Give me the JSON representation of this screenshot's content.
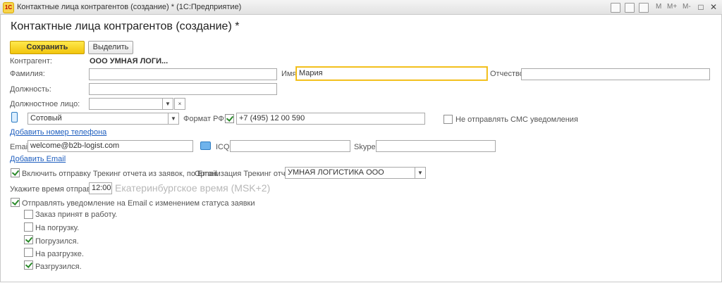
{
  "window": {
    "title": "Контактные лица контрагентов (создание) * (1С:Предприятие)",
    "logo": "1С",
    "toolbar_labels": [
      "M",
      "M+",
      "M-"
    ],
    "controls": [
      "□",
      "✕"
    ]
  },
  "form": {
    "title": "Контактные лица контрагентов (создание) *",
    "buttons": {
      "save": "Сохранить",
      "select": "Выделить"
    },
    "counterparty": {
      "label": "Контрагент:",
      "value": "ООО УМНАЯ ЛОГИ..."
    },
    "surname": {
      "label": "Фамилия:",
      "value": ""
    },
    "name": {
      "label": "Имя:",
      "value": "Мария"
    },
    "patronymic": {
      "label": "Отчество:",
      "value": ""
    },
    "position": {
      "label": "Должность:",
      "value": ""
    },
    "official_position": {
      "label": "Должностное лицо:",
      "value": ""
    },
    "phone": {
      "type_value": "Сотовый",
      "format_label": "Формат РФ:",
      "format_checked": true,
      "number": "+7 (495) 12 00 590",
      "no_sms_label": "Не отправлять СМС уведомления",
      "no_sms_checked": false,
      "add_link": "Добавить номер телефона"
    },
    "email": {
      "label": "Email:",
      "value": "welcome@b2b-logist.com",
      "icq_label": "ICQ:",
      "icq_value": "",
      "skype_label": "Skype:",
      "skype_value": "",
      "add_link": "Добавить Email"
    },
    "tracking": {
      "label": "Включить отправку Трекинг отчета из заявок, по Email.",
      "checked": true,
      "org_label": "Организация Трекинг отчета:",
      "org_value": "УМНАЯ ЛОГИСТИКА ООО"
    },
    "send_time": {
      "label": "Укажите время отправки:",
      "value": "12:00",
      "timezone": "Екатеринбургское время (MSK+2)"
    },
    "status_notify": {
      "label": "Отправлять уведомление на Email с изменением статуса заявки",
      "checked": true,
      "items": [
        {
          "label": "Заказ принят в работу.",
          "checked": false
        },
        {
          "label": "На погрузку.",
          "checked": false
        },
        {
          "label": "Погрузился.",
          "checked": true
        },
        {
          "label": "На разгрузке.",
          "checked": false
        },
        {
          "label": "Разгрузился.",
          "checked": true
        }
      ]
    }
  },
  "icons": {
    "phone": "mobile-phone-icon",
    "mail": "envelope-icon",
    "dropdown": "▼",
    "clear": "×"
  }
}
